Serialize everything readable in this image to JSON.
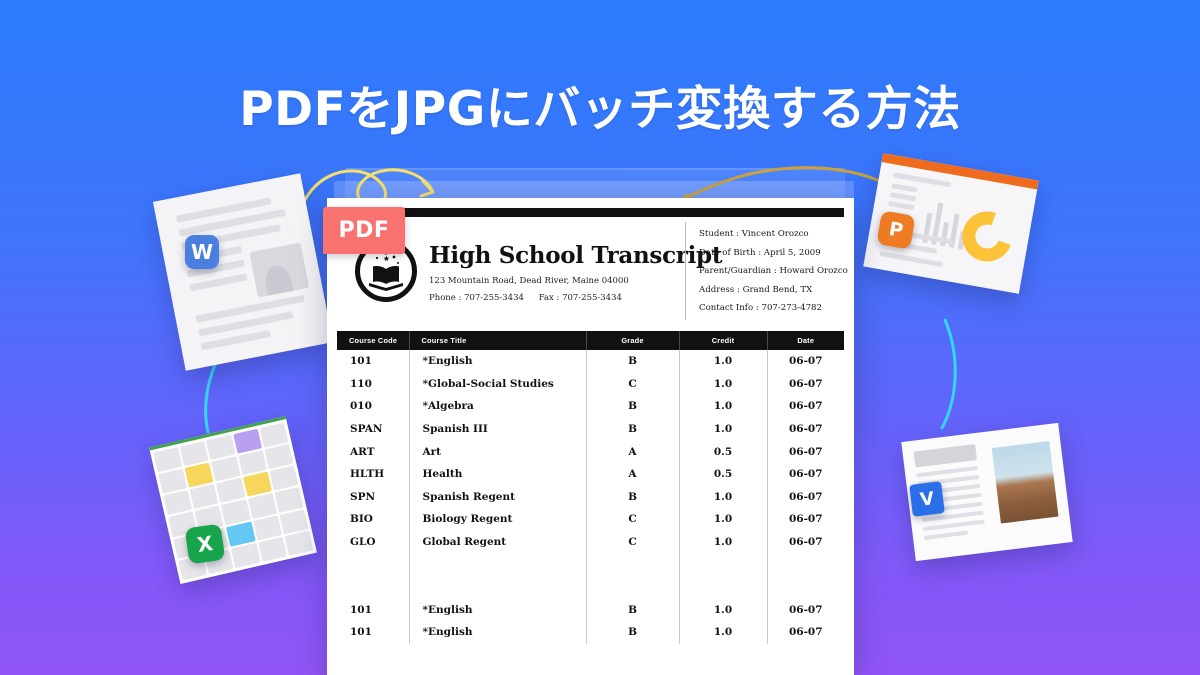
{
  "page": {
    "title": "PDFをJPGにバッチ変換する方法",
    "bg_top_color": "#2b7bfc",
    "bg_bottom_color": "#9155f7"
  },
  "pdf_badge": {
    "label": "PDF",
    "color": "#f8736f"
  },
  "document": {
    "school_title": "High School Transcript",
    "address": "123 Mountain Road, Dead River, Maine 04000",
    "phone_label": "Phone : 707-255-3434",
    "fax_label": "Fax : 707-255-3434",
    "student_info": [
      "Student : Vincent Orozco",
      "Date of Birth : April 5,  2009",
      "Parent/Guardian : Howard Orozco",
      "Address : Grand Bend, TX",
      "Contact Info : 707-273-4782"
    ],
    "table": {
      "headers": [
        "Course Code",
        "Course Title",
        "Grade",
        "Credit",
        "Date"
      ],
      "rows": [
        [
          "101",
          "*English",
          "B",
          "1.0",
          "06-07"
        ],
        [
          "110",
          "*Global-Social Studies",
          "C",
          "1.0",
          "06-07"
        ],
        [
          "010",
          "*Algebra",
          "B",
          "1.0",
          "06-07"
        ],
        [
          "SPAN",
          "Spanish III",
          "B",
          "1.0",
          "06-07"
        ],
        [
          "ART",
          "Art",
          "A",
          "0.5",
          "06-07"
        ],
        [
          "HLTH",
          "Health",
          "A",
          "0.5",
          "06-07"
        ],
        [
          "SPN",
          "Spanish Regent",
          "B",
          "1.0",
          "06-07"
        ],
        [
          "BIO",
          "Biology Regent",
          "C",
          "1.0",
          "06-07"
        ],
        [
          "GLO",
          "Global Regent",
          "C",
          "1.0",
          "06-07"
        ],
        [
          "",
          "",
          "",
          "",
          ""
        ],
        [
          "",
          "",
          "",
          "",
          ""
        ],
        [
          "101",
          "*English",
          "B",
          "1.0",
          "06-07"
        ],
        [
          "101",
          "*English",
          "B",
          "1.0",
          "06-07"
        ]
      ]
    }
  },
  "file_cards": {
    "word": {
      "badge": "W",
      "badge_color": "#4a7fe0"
    },
    "excel": {
      "badge": "X",
      "badge_color": "#18a44a"
    },
    "powerpoint": {
      "badge": "P",
      "badge_color": "#ef7b22"
    },
    "photo": {
      "badge": "V",
      "badge_color": "#2b6fe8"
    }
  },
  "decorations": {
    "arrow_left_color": "#f5e06a",
    "arrow_right_color": "#caa13c",
    "arc_color": "#35d6ef"
  }
}
